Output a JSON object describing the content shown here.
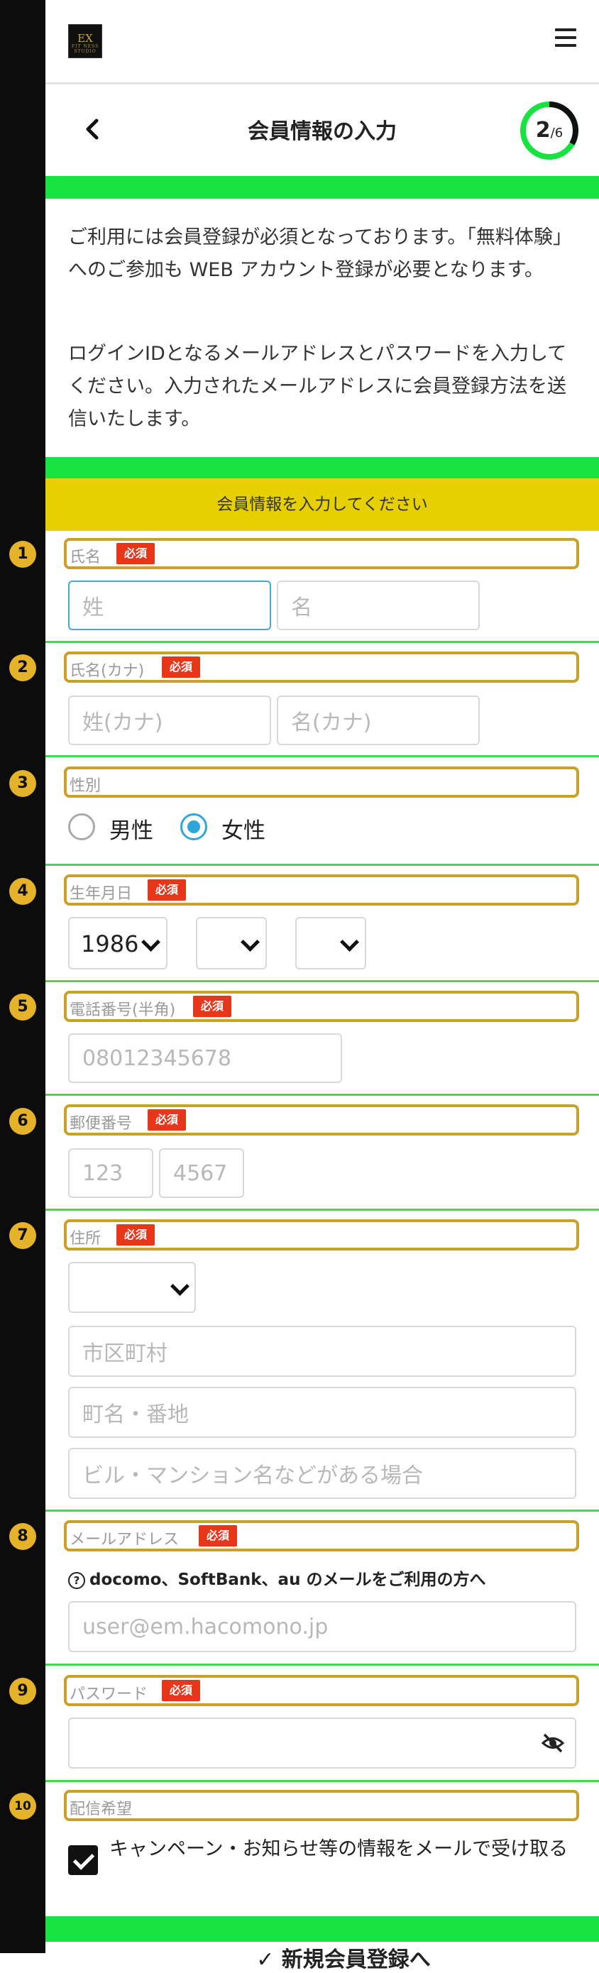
{
  "header": {
    "logo_text": "EX",
    "logo_subtext": "FIT NESS STUDIO",
    "title": "会員情報の入力",
    "progress_current": "2",
    "progress_total": "/6",
    "progress_fraction": 0.333
  },
  "intro": {
    "paragraph1": "ご利用には会員登録が必須となっております。「無料体験」へのご参加も WEB アカウント登録が必要となります。",
    "paragraph2": "ログインIDとなるメールアドレスとパスワードを入力してください。入力されたメールアドレスに会員登録方法を送信いたします。"
  },
  "form_header": "会員情報を入力してください",
  "required_label": "必須",
  "fields": {
    "name": {
      "number": "1",
      "label": "氏名",
      "last_placeholder": "姓",
      "first_placeholder": "名"
    },
    "name_kana": {
      "number": "2",
      "label": "氏名(カナ)",
      "last_placeholder": "姓(カナ)",
      "first_placeholder": "名(カナ)"
    },
    "gender": {
      "number": "3",
      "label": "性別",
      "option_male": "男性",
      "option_female": "女性",
      "selected": "女性"
    },
    "birthdate": {
      "number": "4",
      "label": "生年月日",
      "year_value": "1986",
      "month_value": "",
      "day_value": ""
    },
    "phone": {
      "number": "5",
      "label": "電話番号(半角)",
      "placeholder": "08012345678"
    },
    "postal": {
      "number": "6",
      "label": "郵便番号",
      "part1_placeholder": "123",
      "part2_placeholder": "4567"
    },
    "address": {
      "number": "7",
      "label": "住所",
      "prefecture_value": "",
      "city_placeholder": "市区町村",
      "street_placeholder": "町名・番地",
      "building_placeholder": "ビル・マンション名などがある場合"
    },
    "email": {
      "number": "8",
      "label": "メールアドレス",
      "note": "docomo、SoftBank、au のメールをご利用の方へ",
      "placeholder": "user@em.hacomono.jp"
    },
    "password": {
      "number": "9",
      "label": "パスワード",
      "value": ""
    },
    "newsletter": {
      "number": "10",
      "label": "配信希望",
      "checkbox_label": "キャンペーン・お知らせ等の情報をメールで受け取る",
      "checked": true
    }
  },
  "footer_text": "✓ 新規会員登録へ",
  "colors": {
    "accent_green": "#17e240",
    "highlight_yellow": "#e6d000",
    "annotation_gold": "#c9a028",
    "required_red": "#e8361a",
    "radio_blue": "#2ea6d9"
  }
}
